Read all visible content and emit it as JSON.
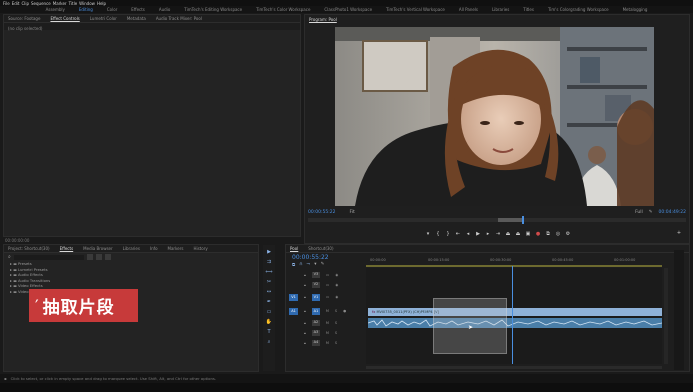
{
  "menubar": {
    "items": [
      "File",
      "Edit",
      "Clip",
      "Sequence",
      "Marker",
      "Title",
      "Window",
      "Help"
    ]
  },
  "workspaces": {
    "items": [
      "Assembly",
      "Editing",
      "Color",
      "Effects",
      "Audio",
      "TimTech's Editing Workspace",
      "TimTech's Color Workspace",
      "ClassPhoto1 Workspace",
      "TimTech's Vertical Workspace",
      "All Panels",
      "Libraries",
      "Titles",
      "Tim's Colorgrading Workspace",
      "Metalogging"
    ],
    "active_index": 1
  },
  "effect_controls": {
    "tabs": [
      "Source: Footage",
      "Effect Controls",
      "Lumetri Color",
      "Metadata",
      "Audio Track Mixer: Pool"
    ],
    "active_index": 1,
    "message": "(no clip selected)"
  },
  "program": {
    "tab": "Program: Pool",
    "timecode": "00:00:55:22",
    "fit_label": "Fit",
    "quality_label": "Full",
    "duration": "00:04:49:22"
  },
  "project": {
    "timecode": "00:00:00:00",
    "tabs": [
      "Project: Shortcut(30)",
      "Effects",
      "Media Browser",
      "Libraries",
      "Info",
      "Markers",
      "History"
    ],
    "active_index": 1,
    "folders": [
      "Presets",
      "Lumetri Presets",
      "Audio Effects",
      "Audio Transitions",
      "Video Effects",
      "Video Transitions"
    ]
  },
  "timeline": {
    "tabs": [
      "Pool",
      "Shortcut(30)"
    ],
    "timecode": "00:00:55:22",
    "ruler": [
      "00:00:00",
      "00:00:15:00",
      "00:00:30:00",
      "00:00:45:00",
      "00:01:00:00"
    ],
    "video_tracks": [
      "V3",
      "V2",
      "V1"
    ],
    "audio_tracks": [
      "A1",
      "A2",
      "A3",
      "A4"
    ],
    "clip_label": "MVI0735_0011(PFX) (CH)PF.MP4 [V]",
    "source_patch": [
      "V1",
      "A1"
    ]
  },
  "overlay": {
    "caption": "抽取片段"
  },
  "status": {
    "message": "Click to select, or click in empty space and drag to marquee select. Use Shift, Alt, and Ctrl for other options."
  },
  "colors": {
    "accent": "#4a8fe0",
    "caption_bg": "#c73a3a",
    "clip_video": "#8fb2d8",
    "clip_audio": "#4a7ea8"
  }
}
